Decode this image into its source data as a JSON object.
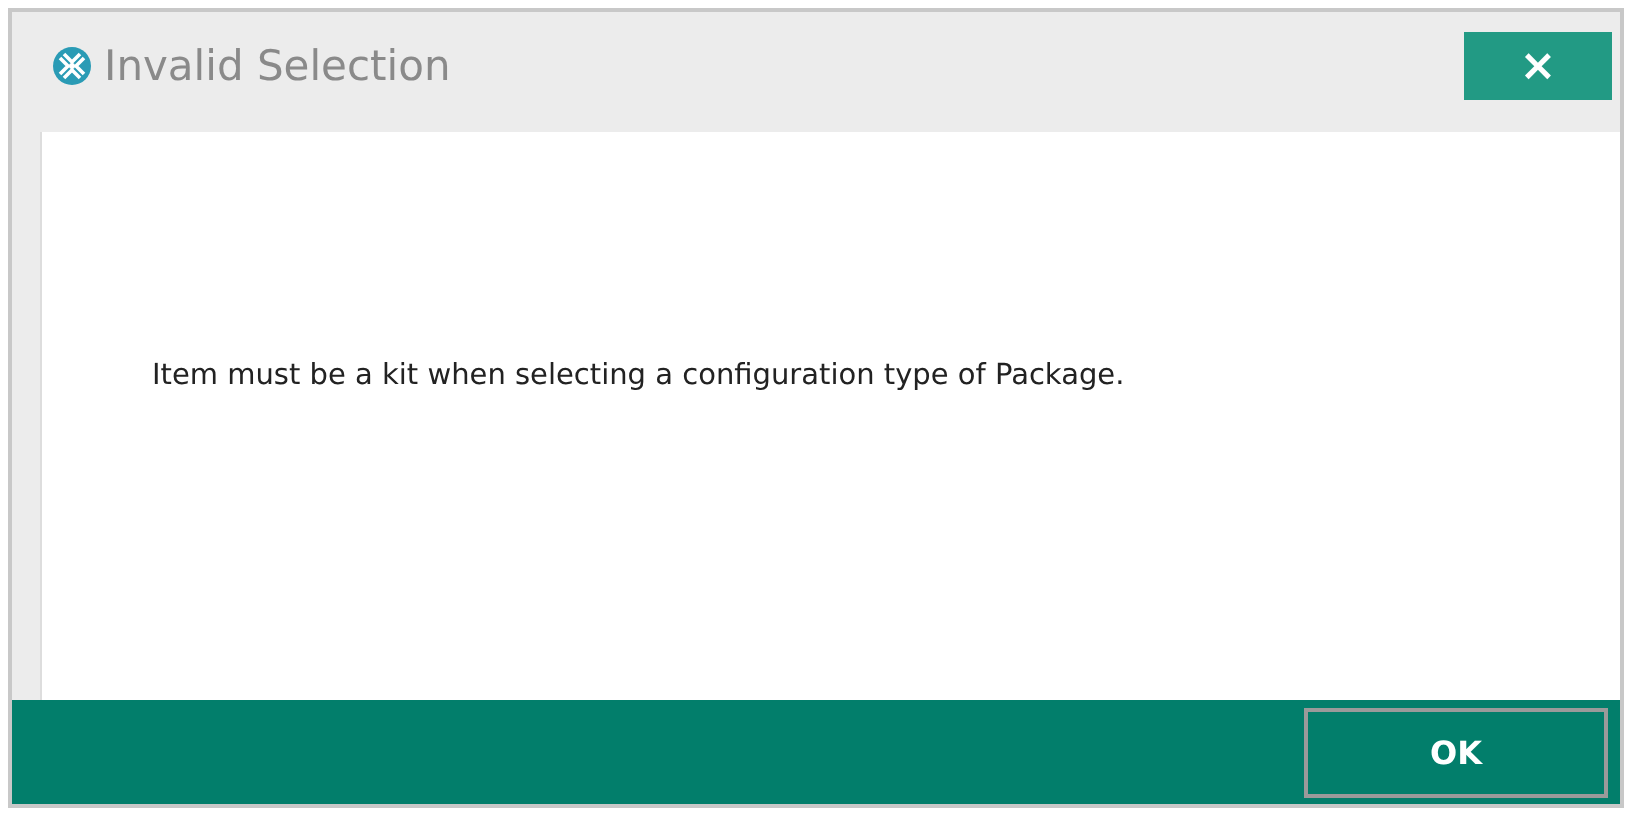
{
  "window": {
    "title": "Invalid Selection",
    "close": "×"
  },
  "message": "Item must be a kit when selecting a configuration type of Package.",
  "buttons": [
    {
      "label": "OK"
    }
  ]
}
